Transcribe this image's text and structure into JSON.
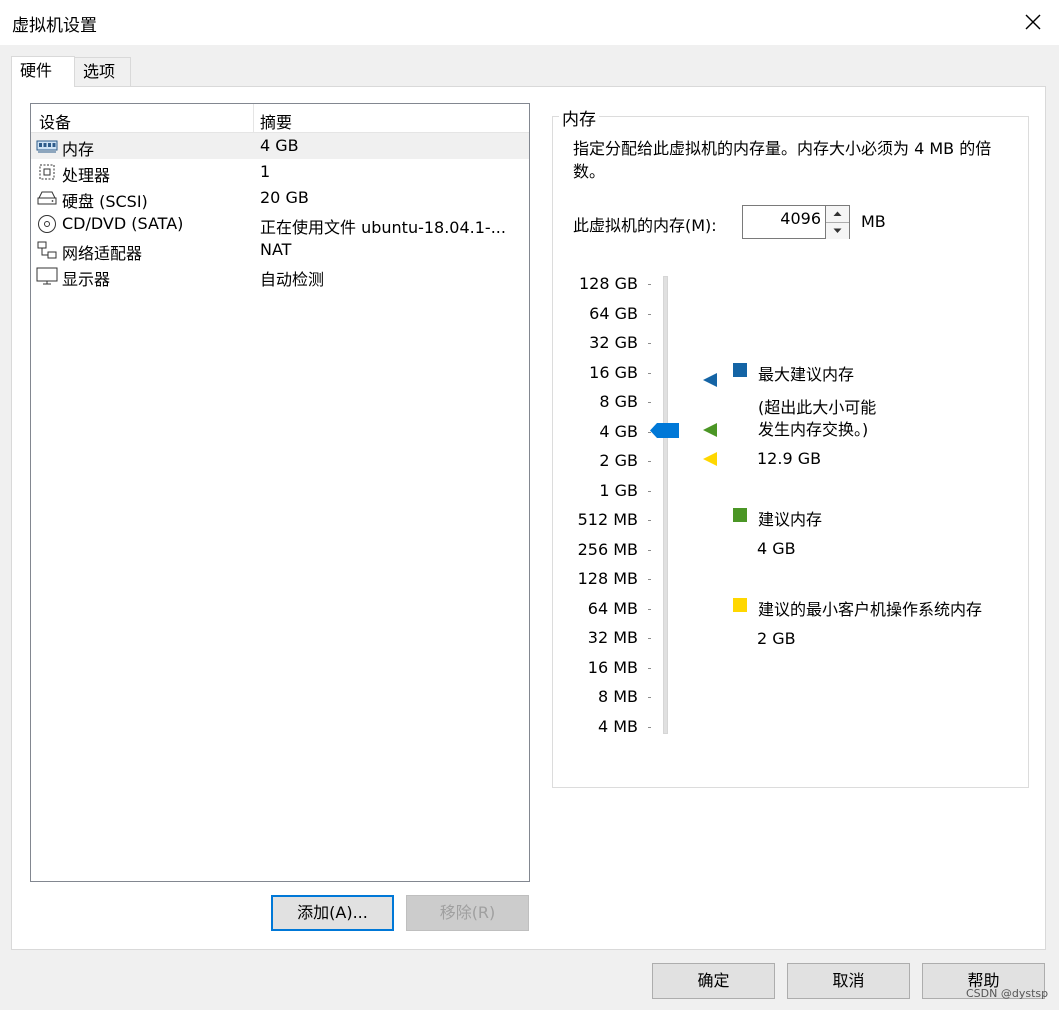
{
  "window": {
    "title": "虚拟机设置"
  },
  "tabs": [
    {
      "label": "硬件"
    },
    {
      "label": "选项"
    }
  ],
  "device_list": {
    "columns": {
      "device": "设备",
      "summary": "摘要"
    },
    "items": [
      {
        "name": "内存",
        "summary": "4 GB",
        "icon": "memory-icon"
      },
      {
        "name": "处理器",
        "summary": "1",
        "icon": "processor-icon"
      },
      {
        "name": "硬盘 (SCSI)",
        "summary": "20 GB",
        "icon": "hard-disk-icon"
      },
      {
        "name": "CD/DVD (SATA)",
        "summary": "正在使用文件 ubuntu-18.04.1-...",
        "icon": "cd-dvd-icon"
      },
      {
        "name": "网络适配器",
        "summary": "NAT",
        "icon": "network-adapter-icon"
      },
      {
        "name": "显示器",
        "summary": "自动检测",
        "icon": "display-icon"
      }
    ]
  },
  "buttons": {
    "add": "添加(A)...",
    "remove": "移除(R)"
  },
  "memory": {
    "group_title": "内存",
    "description": "指定分配给此虚拟机的内存量。内存大小必须为 4 MB 的倍数。",
    "field_label": "此虚拟机的内存(M):",
    "value": "4096",
    "unit": "MB",
    "scale_labels": [
      "128 GB",
      "64 GB",
      "32 GB",
      "16 GB",
      "8 GB",
      "4 GB",
      "2 GB",
      "1 GB",
      "512 MB",
      "256 MB",
      "128 MB",
      "64 MB",
      "32 MB",
      "16 MB",
      "8 MB",
      "4 MB"
    ],
    "max_recommended": {
      "label": "最大建议内存",
      "note_line1": "(超出此大小可能",
      "note_line2": "发生内存交换。)",
      "value": "12.9 GB",
      "color": "#1464a5"
    },
    "recommended": {
      "label": "建议内存",
      "value": "4 GB",
      "color": "#4b9625"
    },
    "min_os": {
      "label": "建议的最小客户机操作系统内存",
      "value": "2 GB",
      "color": "#ffd700"
    },
    "thumb_color": "#0078d7"
  },
  "footer": {
    "ok": "确定",
    "cancel": "取消",
    "help": "帮助"
  },
  "watermark": "CSDN @dystsp"
}
